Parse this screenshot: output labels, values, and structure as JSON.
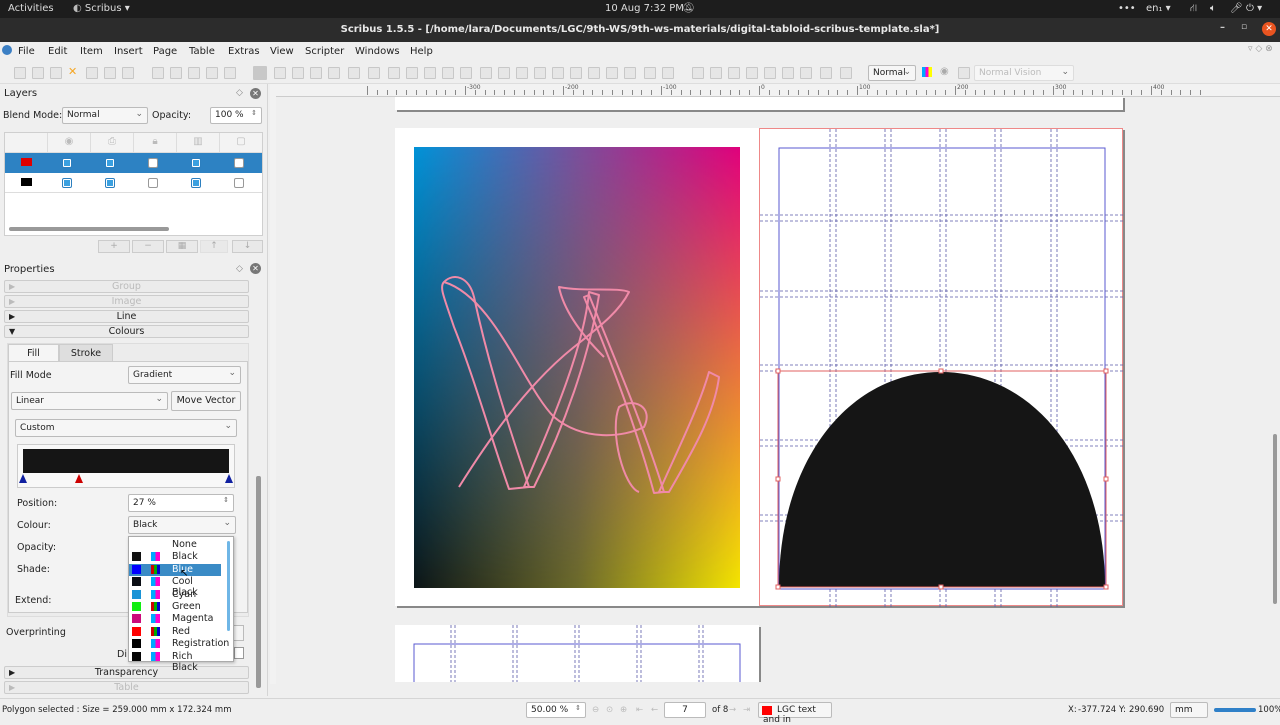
{
  "system_bar": {
    "activities": "Activities",
    "app_menu": "Scribus ▾",
    "clock": "10 Aug  7:32 PM",
    "input_lang": "en₁ ▾"
  },
  "window": {
    "title": "Scribus 1.5.5 - [/home/lara/Documents/LGC/9th-WS/9th-ws-materials/digital-tabloid-scribus-template.sla*]"
  },
  "menu": [
    "File",
    "Edit",
    "Item",
    "Insert",
    "Page",
    "Table",
    "Extras",
    "View",
    "Scripter",
    "Windows",
    "Help"
  ],
  "toolbar": {
    "render_mode": "Normal",
    "vision_mode": "Normal Vision"
  },
  "layers_panel": {
    "title": "Layers",
    "blend_mode_label": "Blend Mode:",
    "blend_mode_value": "Normal",
    "opacity_label": "Opacity:",
    "opacity_value": "100 %",
    "layers": [
      {
        "color": "#e00000",
        "visible": true,
        "printable": true,
        "locked": false,
        "flow": true,
        "outline": false,
        "selected": true
      },
      {
        "color": "#000000",
        "visible": true,
        "printable": true,
        "locked": false,
        "flow": true,
        "outline": false,
        "selected": false
      }
    ],
    "buttons": [
      "+",
      "−",
      "▦",
      "↑",
      "↓"
    ]
  },
  "properties_panel": {
    "title": "Properties",
    "sections": {
      "group": "Group",
      "image": "Image",
      "line": "Line",
      "colours": "Colours",
      "transparency": "Transparency",
      "table": "Table"
    },
    "tabs": {
      "fill": "Fill",
      "stroke": "Stroke"
    },
    "fill_mode_label": "Fill Mode",
    "fill_mode_value": "Gradient",
    "gradient_type": "Linear",
    "move_vector_label": "Move Vector",
    "gradient_preset": "Custom",
    "gradient_stops_percent": [
      0,
      27,
      100
    ],
    "position_label": "Position:",
    "position_value": "27 %",
    "colour_label": "Colour:",
    "colour_value": "Black",
    "opacity_label": "Opacity:",
    "shade_label": "Shade:",
    "extend_label": "Extend:",
    "overprinting_label": "Overprinting",
    "dis_label": "Di"
  },
  "colour_dropdown": {
    "highlighted": "Blue",
    "options": [
      {
        "name": "None",
        "swatch": null,
        "model": "none"
      },
      {
        "name": "Black",
        "swatch": "#111111",
        "model": "cmyk"
      },
      {
        "name": "Blue",
        "swatch": "#0000ff",
        "model": "rgb"
      },
      {
        "name": "Cool Black",
        "swatch": "#0a0d14",
        "model": "cmyk"
      },
      {
        "name": "Cyan",
        "swatch": "#1a93d6",
        "model": "cmyk"
      },
      {
        "name": "Green",
        "swatch": "#11ee11",
        "model": "rgb"
      },
      {
        "name": "Magenta",
        "swatch": "#cc0a7a",
        "model": "cmyk"
      },
      {
        "name": "Red",
        "swatch": "#ff0000",
        "model": "rgb"
      },
      {
        "name": "Registration",
        "swatch": "#000000",
        "model": "cmyk"
      },
      {
        "name": "Rich Black",
        "swatch": "#050505",
        "model": "cmyk"
      }
    ]
  },
  "ruler": {
    "labels": [
      "-300",
      "-200",
      "-100",
      "0",
      "100",
      "200",
      "300",
      "400"
    ]
  },
  "status": {
    "message": "Polygon selected : Size = 259.000 mm x 172.324 mm",
    "zoom": "50.00 %",
    "page": "7",
    "page_of": "of 8",
    "layer": "LGC text and in",
    "layer_color": "#ff0000",
    "x_label": "X:",
    "x_value": "-377.724",
    "y_label": "Y:",
    "y_value": "290.690",
    "unit": "mm",
    "zoom_slider_percent": 100,
    "zoom_slider_label": "100%"
  }
}
